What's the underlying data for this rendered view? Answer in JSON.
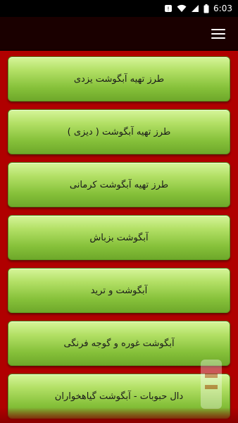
{
  "status_bar": {
    "time": "6:03",
    "icons": [
      "wifi-icon",
      "signal-icon",
      "battery-icon",
      "notification-icon"
    ]
  },
  "app_bar": {
    "menu_icon": "hamburger-menu-icon"
  },
  "items": [
    {
      "label": "طرز تهیه آبگوشت یزدی"
    },
    {
      "label": "طرز تهیه آبگوشت ( دیزی )"
    },
    {
      "label": "طرز تهیه آبگوشت کرمانی"
    },
    {
      "label": "آبگوشت بزباش"
    },
    {
      "label": "آبگوشت و ترید"
    },
    {
      "label": "آبگوشت غوره و گوجه فرنگی"
    },
    {
      "label": "دال حبوبات - آبگوشت گیاهخواران"
    }
  ],
  "colors": {
    "background": "#b00000",
    "status_bar": "#000000",
    "app_bar": "#1a0000",
    "item_top": "#d6f59a",
    "item_bottom": "#6ea82a"
  }
}
